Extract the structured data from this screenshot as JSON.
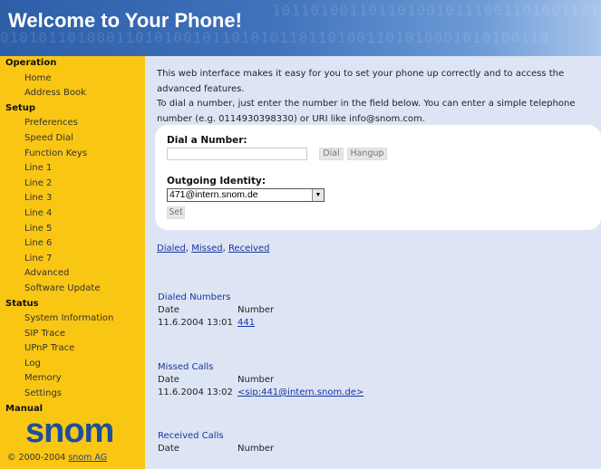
{
  "header": {
    "title": "Welcome to Your Phone!",
    "background_binary": [
      "10110100110110100101110011010011011100101110100110101",
      "010101101000110101001011010101101101001101010001010100110"
    ]
  },
  "sidebar": {
    "sections": [
      {
        "label": "Operation",
        "items": [
          "Home",
          "Address Book"
        ]
      },
      {
        "label": "Setup",
        "items": [
          "Preferences",
          "Speed Dial",
          "Function Keys",
          "Line 1",
          "Line 2",
          "Line 3",
          "Line 4",
          "Line 5",
          "Line 6",
          "Line 7",
          "Advanced",
          "Software Update"
        ]
      },
      {
        "label": "Status",
        "items": [
          "System Information",
          "SIP Trace",
          "UPnP Trace",
          "Log",
          "Memory",
          "Settings"
        ]
      },
      {
        "label": "Manual",
        "items": []
      }
    ],
    "logo_text": "snom",
    "copyright_prefix": "© 2000-2004",
    "copyright_link": "snom AG",
    "background_color": "#f9c614"
  },
  "main": {
    "intro": [
      "This web interface makes it easy for you to set your phone up correctly and to access the advanced features.",
      "To dial a number, just enter the number in the field below. You can enter a simple telephone number (e.g. 0114930398330) or URI like info@snom.com."
    ],
    "dial": {
      "label": "Dial a Number:",
      "value": "",
      "dial_button": "Dial",
      "hangup_button": "Hangup"
    },
    "identity": {
      "label": "Outgoing Identity:",
      "selected": "471@intern.snom.de",
      "set_button": "Set"
    },
    "links": {
      "dialed": "Dialed",
      "missed": "Missed",
      "received": "Received",
      "separator": ", "
    },
    "dialed_numbers": {
      "heading": "Dialed Numbers",
      "col_date": "Date",
      "col_number": "Number",
      "rows": [
        {
          "date": "11.6.2004 13:01",
          "number": "441"
        }
      ]
    },
    "missed_calls": {
      "heading": "Missed Calls",
      "col_date": "Date",
      "col_number": "Number",
      "rows": [
        {
          "date": "11.6.2004 13:02",
          "number": "<sip:441@intern.snom.de>"
        }
      ]
    },
    "received_calls": {
      "heading": "Received Calls",
      "col_date": "Date",
      "col_number": "Number",
      "rows": []
    }
  }
}
